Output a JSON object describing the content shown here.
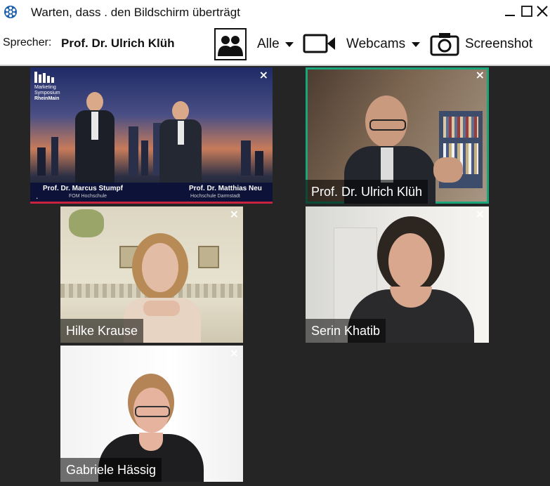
{
  "window": {
    "title": "Warten, dass . den Bildschirm überträgt"
  },
  "toolbar": {
    "speaker_label": "Sprecher:",
    "speaker_name": "Prof. Dr. Ulrich Klüh",
    "audience_label": "Alle",
    "webcams_label": "Webcams",
    "screenshot_label": "Screenshot"
  },
  "stage": {
    "logo_lines": [
      "Marketing",
      "Symposium",
      "RheinMain"
    ],
    "left_name": "Prof. Dr. Marcus Stumpf",
    "left_affil": "FOM Hochschule",
    "right_name": "Prof. Dr. Matthias Neu",
    "right_affil": "Hochschule Darmstadt",
    "dot": "."
  },
  "tiles": [
    {
      "name": "Prof. Dr. Ulrich Klüh",
      "active": true
    },
    {
      "name": "Hilke Krause",
      "active": false
    },
    {
      "name": "Serin Khatib",
      "active": false
    },
    {
      "name": "Gabriele Hässig",
      "active": false
    }
  ],
  "close_glyph": "×",
  "colors": {
    "active_border": "#1aa57a",
    "video_bg": "#252525",
    "stage_caption_bar": "#c8223f"
  },
  "icons": [
    "app-logo-icon",
    "minimize-icon",
    "maximize-icon",
    "close-icon",
    "people-icon",
    "video-camera-icon",
    "camera-icon",
    "caret-down-icon"
  ]
}
